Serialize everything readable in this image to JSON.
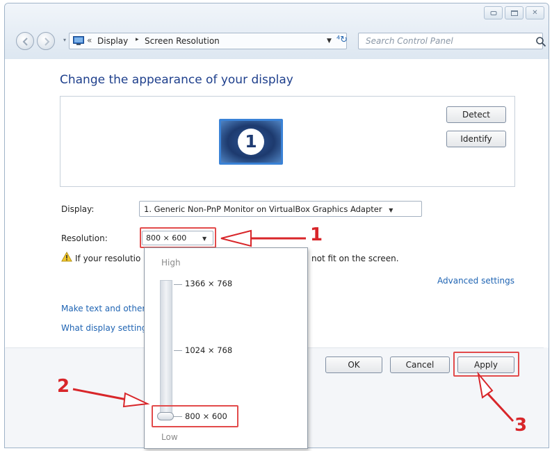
{
  "window": {
    "caption_buttons": [
      "minimize-icon",
      "maximize-icon",
      "close-icon"
    ]
  },
  "address_bar": {
    "chevron": "«",
    "crumbs": [
      "Display",
      "Screen Resolution"
    ],
    "separator": "▸"
  },
  "search": {
    "placeholder": "Search Control Panel"
  },
  "main": {
    "heading": "Change the appearance of your display",
    "monitor_number": "1",
    "detect_label": "Detect",
    "identify_label": "Identify",
    "display_label": "Display:",
    "display_value": "1. Generic Non-PnP Monitor on VirtualBox Graphics Adapter",
    "resolution_label": "Resolution:",
    "resolution_value": "800 × 600",
    "warning_text": "If your resolutio",
    "warning_tail": "not fit on the screen.",
    "advanced_link": "Advanced settings",
    "link_text_size": "Make text and other",
    "link_display_settings": "What display setting"
  },
  "buttons": {
    "ok": "OK",
    "cancel": "Cancel",
    "apply": "Apply"
  },
  "resolution_dropdown": {
    "high_label": "High",
    "low_label": "Low",
    "options": [
      "1366 × 768",
      "1024 × 768",
      "800 × 600"
    ],
    "selected": "800 × 600"
  },
  "annotations": {
    "step1": "1",
    "step2": "2",
    "step3": "3",
    "color": "#d8262a"
  }
}
